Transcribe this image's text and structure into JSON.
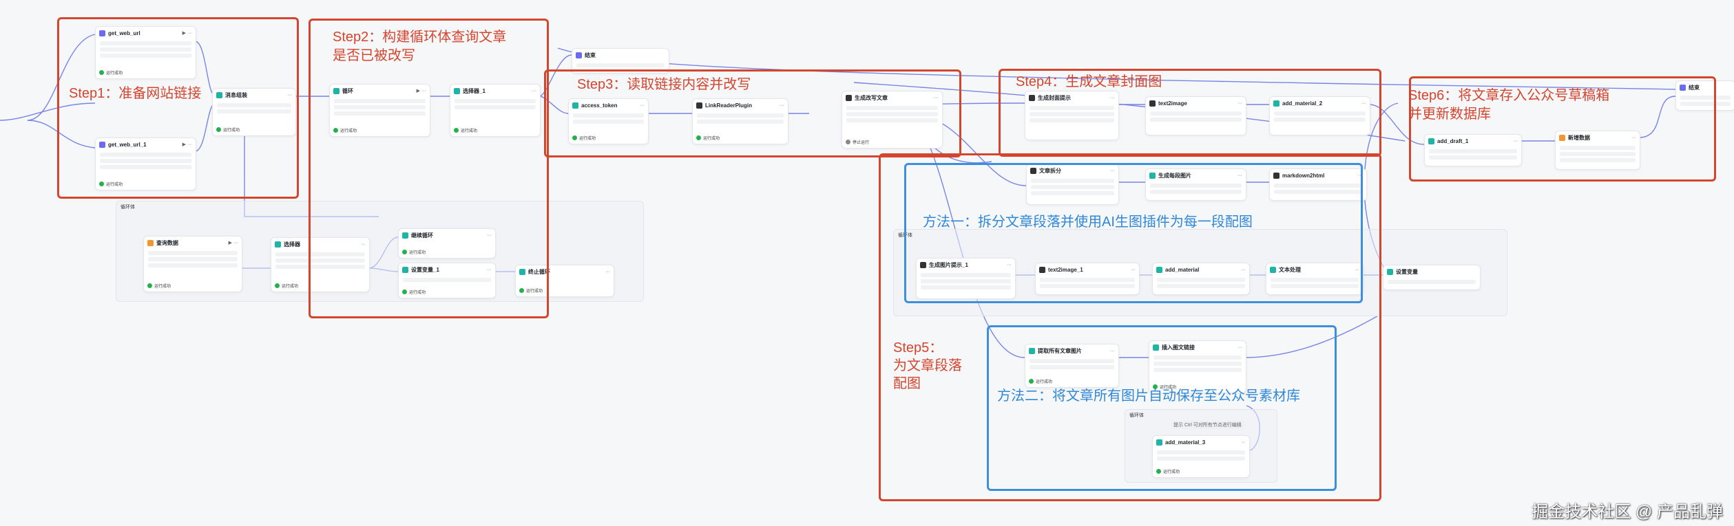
{
  "colors": {
    "accent_red": "#d4452e",
    "accent_blue": "#3b8fdc",
    "success": "#22b14c"
  },
  "steps": {
    "step1": "Step1：准备网站链接",
    "step2_l1": "Step2：构建循环体查询文章",
    "step2_l2": "是否已被改写",
    "step3": "Step3：读取链接内容并改写",
    "step4": "Step4：生成文章封面图",
    "step5_l1": "Step5：",
    "step5_l2": "为文章段落",
    "step5_l3": "配图",
    "step6_l1": "Step6：将文章存入公众号草稿箱",
    "step6_l2": "并更新数据库",
    "method1": "方法一：拆分文章段落并使用AI生图插件为每一段配图",
    "method2": "方法二：将文章所有图片自动保存至公众号素材库"
  },
  "nodes": {
    "get_web_url": "get_web_url",
    "get_web_url_1": "get_web_url_1",
    "merge": "消息组装",
    "loop_ctrl": "循环",
    "select_1": "选择器_1",
    "end_top": "结束",
    "loop_body": "循环体",
    "query_db": "查询数据",
    "selector": "选择器",
    "continue_loop": "继续循环",
    "set_var_1": "设置变量_1",
    "stop_loop": "终止循环",
    "access_token": "access_token",
    "link_reader": "LinkReaderPlugin",
    "gen_article": "生成改写文章",
    "stop_run": "停止运行",
    "gen_title": "生成封面提示",
    "text2image": "text2image",
    "add_material_2": "add_material_2",
    "add_draft_1": "add_draft_1",
    "update_db": "新增数据",
    "end_right": "结束",
    "split_article": "文章拆分",
    "gen_images": "生成每段图片",
    "markdown2html": "markdown2html",
    "loop_body_2": "循环体",
    "gen_prompt_1": "生成图片提示_1",
    "text2image_1": "text2image_1",
    "add_material": "add_material",
    "merge_2": "文本处理",
    "set_var": "设置变量",
    "extract_images": "提取所有文章图片",
    "insert_images": "插入图文链接",
    "loop_body_3": "循环体",
    "loop_hint": "提示 Ctrl 可对所有节点进行编辑",
    "add_material_3": "add_material_3"
  },
  "status": {
    "ok": "运行成功"
  },
  "watermark": "掘金技术社区 @ 产品乱弹"
}
